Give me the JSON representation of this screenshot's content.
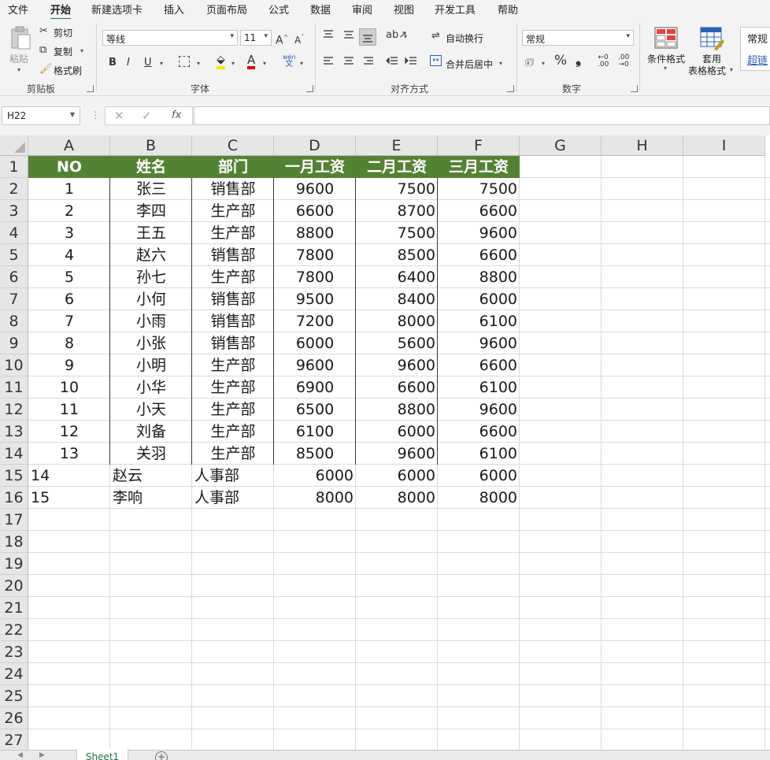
{
  "menu": {
    "tabs": [
      "文件",
      "开始",
      "新建选项卡",
      "插入",
      "页面布局",
      "公式",
      "数据",
      "审阅",
      "视图",
      "开发工具",
      "帮助"
    ],
    "active_tab": "开始"
  },
  "ribbon": {
    "clipboard": {
      "paste": "粘贴",
      "cut": "剪切",
      "copy": "复制",
      "format_painter": "格式刷",
      "label": "剪贴板"
    },
    "font": {
      "name": "等线",
      "size": "11",
      "label": "字体",
      "wen": "wén",
      "wen_char": "文"
    },
    "alignment": {
      "wrap_text": "自动换行",
      "merge_center": "合并后居中",
      "label": "对齐方式"
    },
    "number": {
      "format": "常规",
      "label": "数字"
    },
    "styles": {
      "conditional_format": "条件格式",
      "format_as_table_1": "套用",
      "format_as_table_2": "表格格式",
      "style_normal": "常规",
      "style_hyperlink": "超链"
    }
  },
  "formula_bar": {
    "name_box": "H22",
    "formula": ""
  },
  "sheet": {
    "column_headers": [
      "A",
      "B",
      "C",
      "D",
      "E",
      "F",
      "G",
      "H",
      "I"
    ],
    "row_numbers": [
      "1",
      "2",
      "3",
      "4",
      "5",
      "6",
      "7",
      "8",
      "9",
      "10",
      "11",
      "12",
      "13",
      "14",
      "15",
      "16",
      "17",
      "18",
      "19",
      "20",
      "21",
      "22",
      "23",
      "24",
      "25",
      "26",
      "27"
    ],
    "table_headers": [
      "NO",
      "姓名",
      "部门",
      "一月工资",
      "二月工资",
      "三月工资"
    ],
    "table_rows": [
      [
        "1",
        "张三",
        "销售部",
        "9600",
        "7500",
        "7500"
      ],
      [
        "2",
        "李四",
        "生产部",
        "6600",
        "8700",
        "6600"
      ],
      [
        "3",
        "王五",
        "生产部",
        "8800",
        "7500",
        "9600"
      ],
      [
        "4",
        "赵六",
        "销售部",
        "7800",
        "8500",
        "6600"
      ],
      [
        "5",
        "孙七",
        "生产部",
        "7800",
        "6400",
        "8800"
      ],
      [
        "6",
        "小何",
        "销售部",
        "9500",
        "8400",
        "6000"
      ],
      [
        "7",
        "小雨",
        "销售部",
        "7200",
        "8000",
        "6100"
      ],
      [
        "8",
        "小张",
        "销售部",
        "6000",
        "5600",
        "9600"
      ],
      [
        "9",
        "小明",
        "生产部",
        "9600",
        "9600",
        "6600"
      ],
      [
        "10",
        "小华",
        "生产部",
        "6900",
        "6600",
        "6100"
      ],
      [
        "11",
        "小天",
        "生产部",
        "6500",
        "8800",
        "9600"
      ],
      [
        "12",
        "刘备",
        "生产部",
        "6100",
        "6000",
        "6600"
      ],
      [
        "13",
        "关羽",
        "生产部",
        "8500",
        "9600",
        "6100"
      ]
    ],
    "extra_rows": [
      [
        "14",
        "赵云",
        "人事部",
        "6000",
        "6000",
        "6000"
      ],
      [
        "15",
        "李响",
        "人事部",
        "8000",
        "8000",
        "8000"
      ]
    ],
    "header_fill_color": "#548235",
    "active_sheet": "Sheet1"
  }
}
